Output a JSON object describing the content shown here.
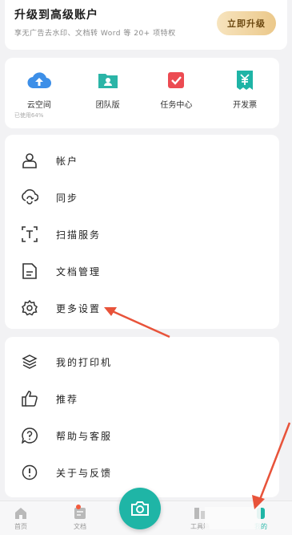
{
  "upgrade": {
    "title": "升级到高级账户",
    "subtitle": "享无广告去水印、文档转 Word 等 20+ 项特权",
    "button": "立即升级"
  },
  "quick": [
    {
      "label": "云空间",
      "sub": "已使用64%",
      "icon": "cloud-upload-icon",
      "color": "#3d8fe8"
    },
    {
      "label": "团队版",
      "sub": "",
      "icon": "team-folder-icon",
      "color": "#2bb5a7"
    },
    {
      "label": "任务中心",
      "sub": "",
      "icon": "task-check-icon",
      "color": "#ec4b52"
    },
    {
      "label": "开发票",
      "sub": "",
      "icon": "invoice-yen-icon",
      "color": "#1eb4a6"
    }
  ],
  "menu1": [
    {
      "label": "帐户",
      "icon": "user-icon"
    },
    {
      "label": "同步",
      "icon": "cloud-sync-icon"
    },
    {
      "label": "扫描服务",
      "icon": "scan-text-icon"
    },
    {
      "label": "文档管理",
      "icon": "document-icon"
    },
    {
      "label": "更多设置",
      "icon": "gear-icon"
    }
  ],
  "menu2": [
    {
      "label": "我的打印机",
      "icon": "layers-icon"
    },
    {
      "label": "推荐",
      "icon": "thumbs-up-icon"
    },
    {
      "label": "帮助与客服",
      "icon": "help-chat-icon"
    },
    {
      "label": "关于与反馈",
      "icon": "info-icon"
    }
  ],
  "tabs": [
    {
      "label": "首页",
      "icon": "home-icon"
    },
    {
      "label": "文档",
      "icon": "docs-tab-icon"
    },
    {
      "label": "工具箱",
      "icon": "toolbox-icon"
    },
    {
      "label": "我的",
      "icon": "profile-tab-icon"
    }
  ],
  "colors": {
    "accent": "#1fb5a6",
    "annotation": "#e8533a",
    "gold": "#ebc88a"
  }
}
